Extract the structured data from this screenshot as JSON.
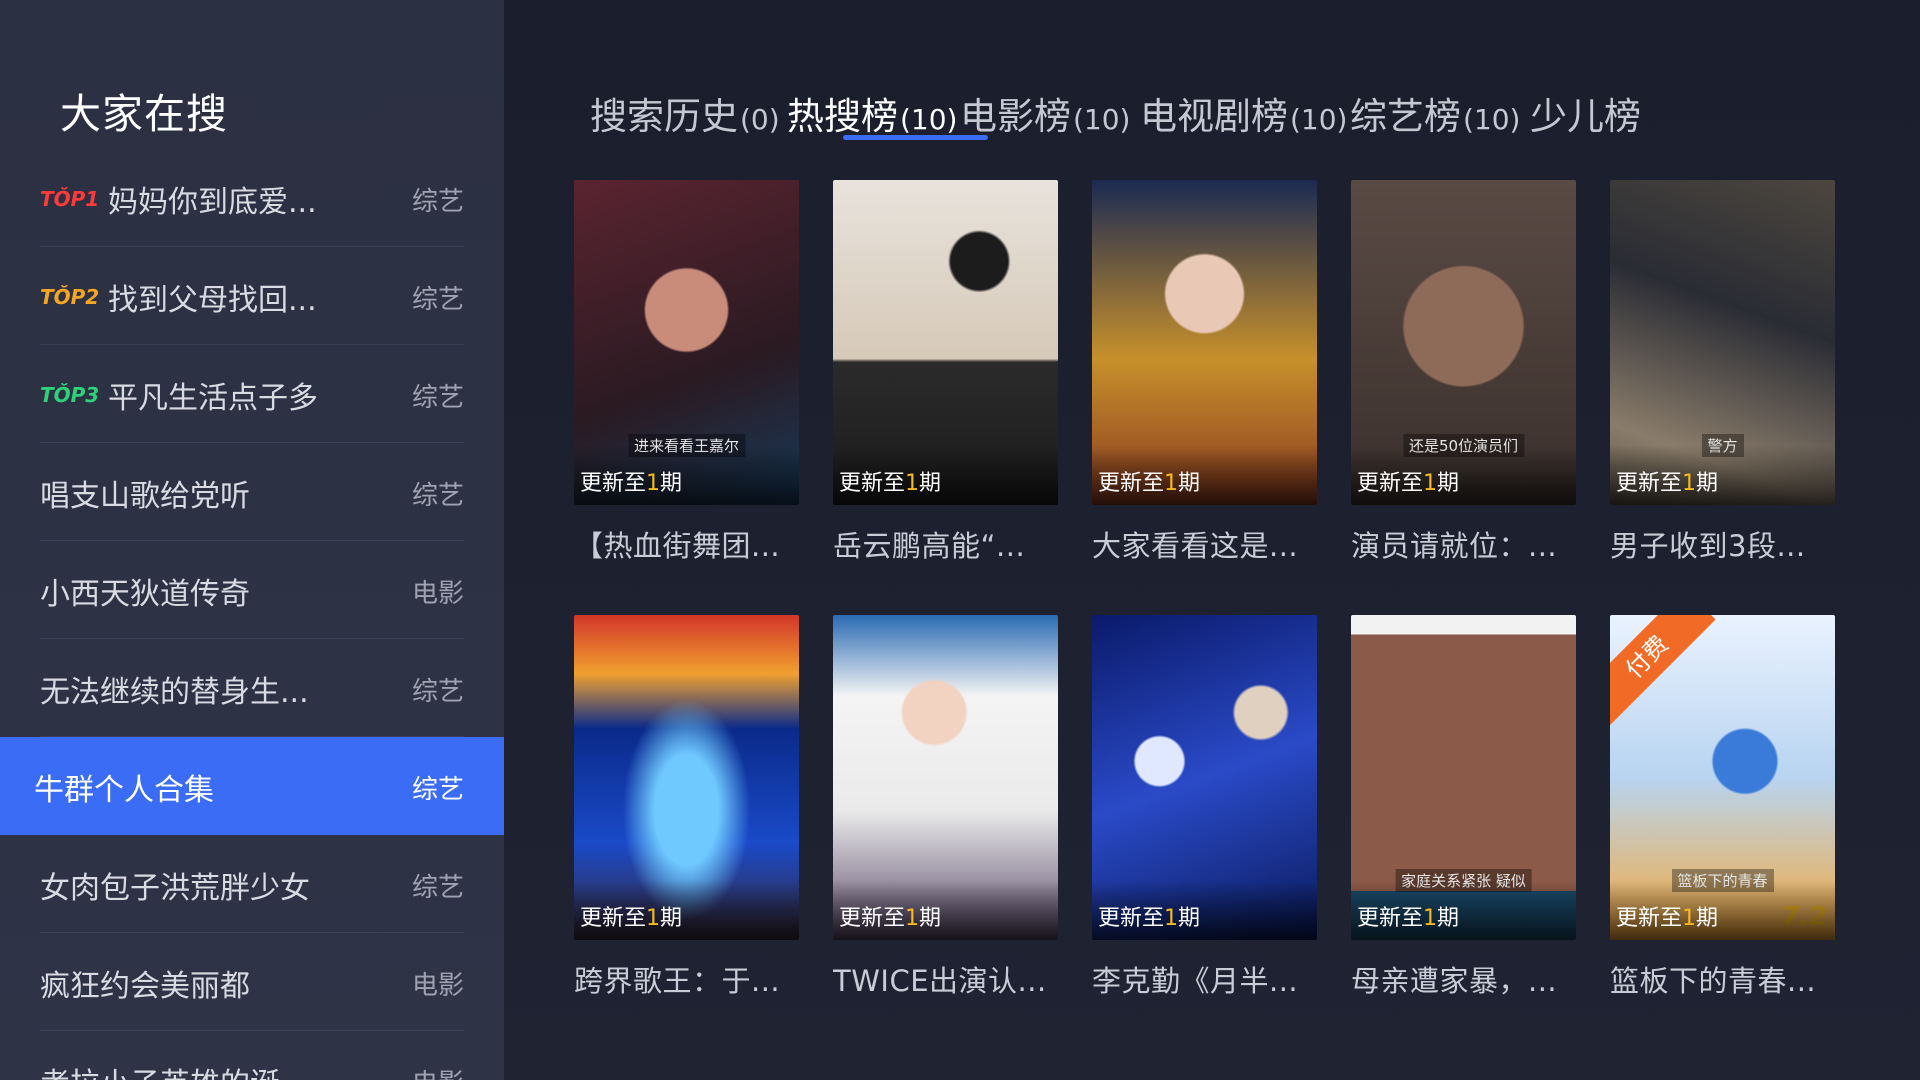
{
  "sidebar": {
    "title": "大家在搜",
    "items": [
      {
        "rank_label": "TŎP1",
        "rank_color": "#ff3a3a",
        "name": "妈妈你到底爱...",
        "category": "综艺"
      },
      {
        "rank_label": "TŎP2",
        "rank_color": "#f6a623",
        "name": "找到父母找回...",
        "category": "综艺"
      },
      {
        "rank_label": "TŎP3",
        "rank_color": "#2fd27a",
        "name": "平凡生活点子多",
        "category": "综艺"
      },
      {
        "rank_label": "",
        "name": "唱支山歌给党听",
        "category": "综艺"
      },
      {
        "rank_label": "",
        "name": "小西天狄道传奇",
        "category": "电影"
      },
      {
        "rank_label": "",
        "name": "无法继续的替身生...",
        "category": "综艺"
      },
      {
        "rank_label": "",
        "name": "牛群个人合集",
        "category": "综艺",
        "selected": true
      },
      {
        "rank_label": "",
        "name": "女肉包子洪荒胖少女",
        "category": "综艺"
      },
      {
        "rank_label": "",
        "name": "疯狂约会美丽都",
        "category": "电影"
      },
      {
        "rank_label": "",
        "name": "考拉小子英雄的诞",
        "category": "电影"
      }
    ]
  },
  "tabs": [
    {
      "label": "搜索历史",
      "count": "(0)"
    },
    {
      "label": "热搜榜",
      "count": "(10)",
      "active": true
    },
    {
      "label": "电影榜",
      "count": "(10)"
    },
    {
      "label": "电视剧榜",
      "count": "(10)"
    },
    {
      "label": "综艺榜",
      "count": "(10)"
    },
    {
      "label": "少儿榜",
      "count": ""
    }
  ],
  "update_prefix": "更新至",
  "update_num": "1",
  "update_suffix": "期",
  "cards": [
    {
      "title": "【热血街舞团...",
      "poster_caption": "进来看看王嘉尔"
    },
    {
      "title": "岳云鹏高能“..."
    },
    {
      "title": "大家看看这是..."
    },
    {
      "title": "演员请就位：...",
      "poster_caption": "还是50位演员们"
    },
    {
      "title": "男子收到3段...",
      "poster_caption": "警方"
    },
    {
      "title": "跨界歌王：于..."
    },
    {
      "title": "TWICE出演认..."
    },
    {
      "title": "李克勤《月半..."
    },
    {
      "title": "母亲遭家暴，...",
      "poster_caption": "家庭关系紧张 疑似"
    },
    {
      "title": "篮板下的青春...",
      "paid_label": "付费",
      "score": "7.2",
      "poster_caption": "篮板下的青春"
    }
  ],
  "colors": {
    "accent": "#3b6cf5",
    "update_highlight": "#f6b91e",
    "paid": "#f26b26"
  }
}
